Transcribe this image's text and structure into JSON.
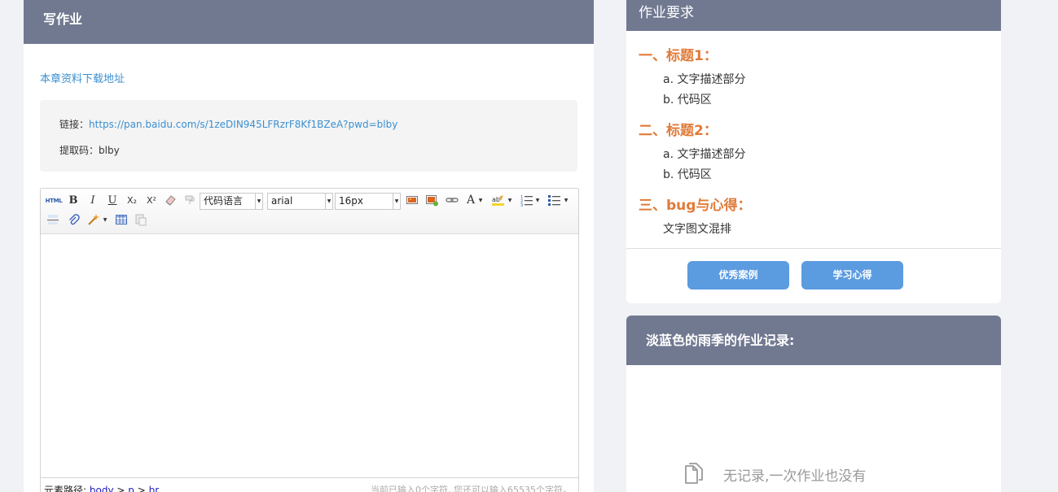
{
  "write": {
    "title": "写作业",
    "download_link": "本章资料下载地址",
    "link_label": "链接：",
    "link_url": "https://pan.baidu.com/s/1zeDIN945LFRzrF8Kf1BZeA?pwd=blby",
    "code_label": "提取码：blby"
  },
  "editor": {
    "toolbar": {
      "html": "HTML",
      "bold": "B",
      "italic": "I",
      "underline": "U",
      "subscript": "X₂",
      "superscript": "X²",
      "font_color": "A",
      "code_language": "代码语言",
      "font_family": "arial",
      "font_size": "16px"
    },
    "status": {
      "path_label": "元素路径:",
      "path_body": "body",
      "sep1": ">",
      "path_p": "p",
      "sep2": ">",
      "path_br": "br",
      "counter": "当前已输入0个字符, 您还可以输入65535个字符。"
    }
  },
  "requirements": {
    "title": "作业要求",
    "sections": [
      {
        "title": "一、标题1：",
        "items": [
          "a. 文字描述部分",
          "b. 代码区"
        ]
      },
      {
        "title": "二、标题2：",
        "items": [
          "a. 文字描述部分",
          "b. 代码区"
        ]
      },
      {
        "title": "三、bug与心得：",
        "items": [
          "文字图文混排"
        ]
      }
    ],
    "btn_excellent": "优秀案例",
    "btn_learning": "学习心得"
  },
  "records": {
    "title": "淡蓝色的雨季的作业记录:",
    "empty_text": "无记录,一次作业也没有"
  }
}
